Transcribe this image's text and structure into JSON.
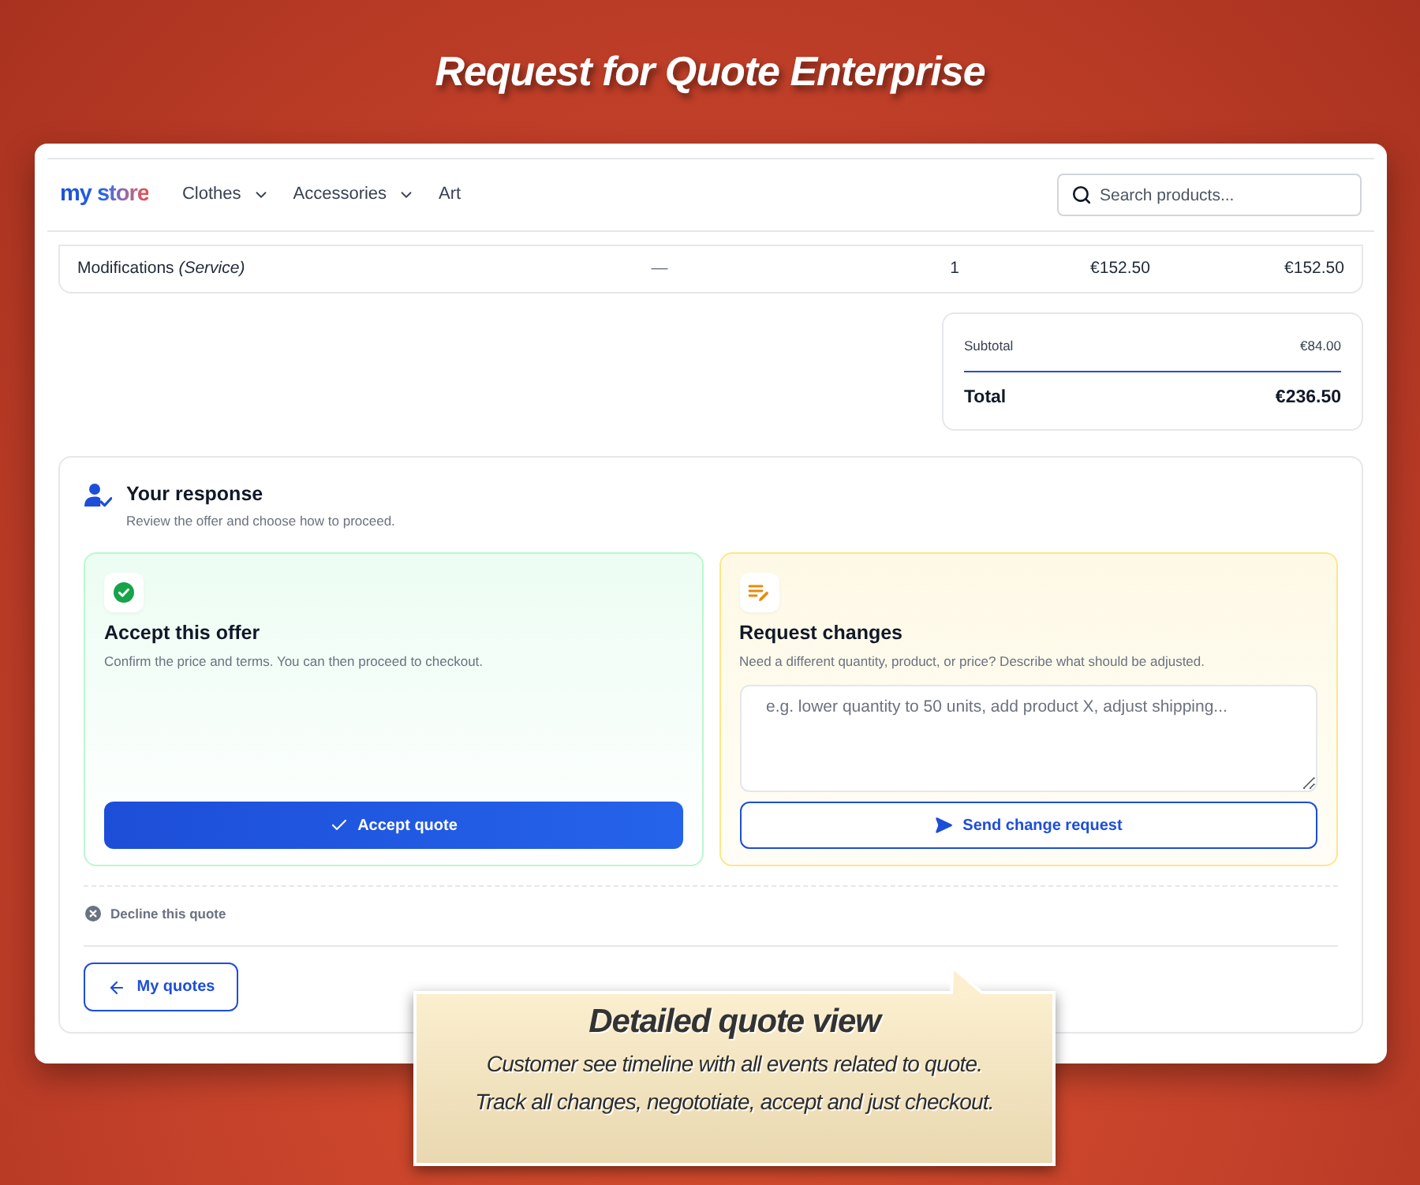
{
  "banner": {
    "title": "Request for Quote Enterprise"
  },
  "header": {
    "logo": "my store",
    "nav": [
      {
        "label": "Clothes",
        "has_menu": true
      },
      {
        "label": "Accessories",
        "has_menu": true
      },
      {
        "label": "Art",
        "has_menu": false
      }
    ],
    "search": {
      "placeholder": "Search products..."
    }
  },
  "table": {
    "rows": [
      {
        "cells": [
          "Modifications *(Service)*",
          "—",
          "1",
          "€152.50",
          "€152.50"
        ]
      }
    ]
  },
  "totals": {
    "rows": [
      {
        "label": "Subtotal",
        "value": "€84.00"
      }
    ],
    "total": {
      "label": "Total",
      "value": "€236.50"
    }
  },
  "response": {
    "title": "Your response",
    "subtitle": "Review the offer and choose how to proceed.",
    "options": [
      {
        "kind": "accept",
        "title": "Accept this offer",
        "description": "Confirm the price and terms. You can then proceed to checkout.",
        "button": "Accept quote"
      },
      {
        "kind": "request",
        "title": "Request changes",
        "description": "Need a different quantity, product, or price? Describe what should be adjusted.",
        "textarea": {
          "placeholder": "e.g. lower quantity to 50 units, add product X, adjust shipping..."
        },
        "button": "Send change request"
      }
    ],
    "decline": "Decline this quote",
    "back_button": "My quotes"
  },
  "callout": {
    "title": "Detailed quote view",
    "lines": [
      "Customer see timeline with all events related to quote.",
      "Track all changes, negototiate, accept and just checkout."
    ]
  }
}
